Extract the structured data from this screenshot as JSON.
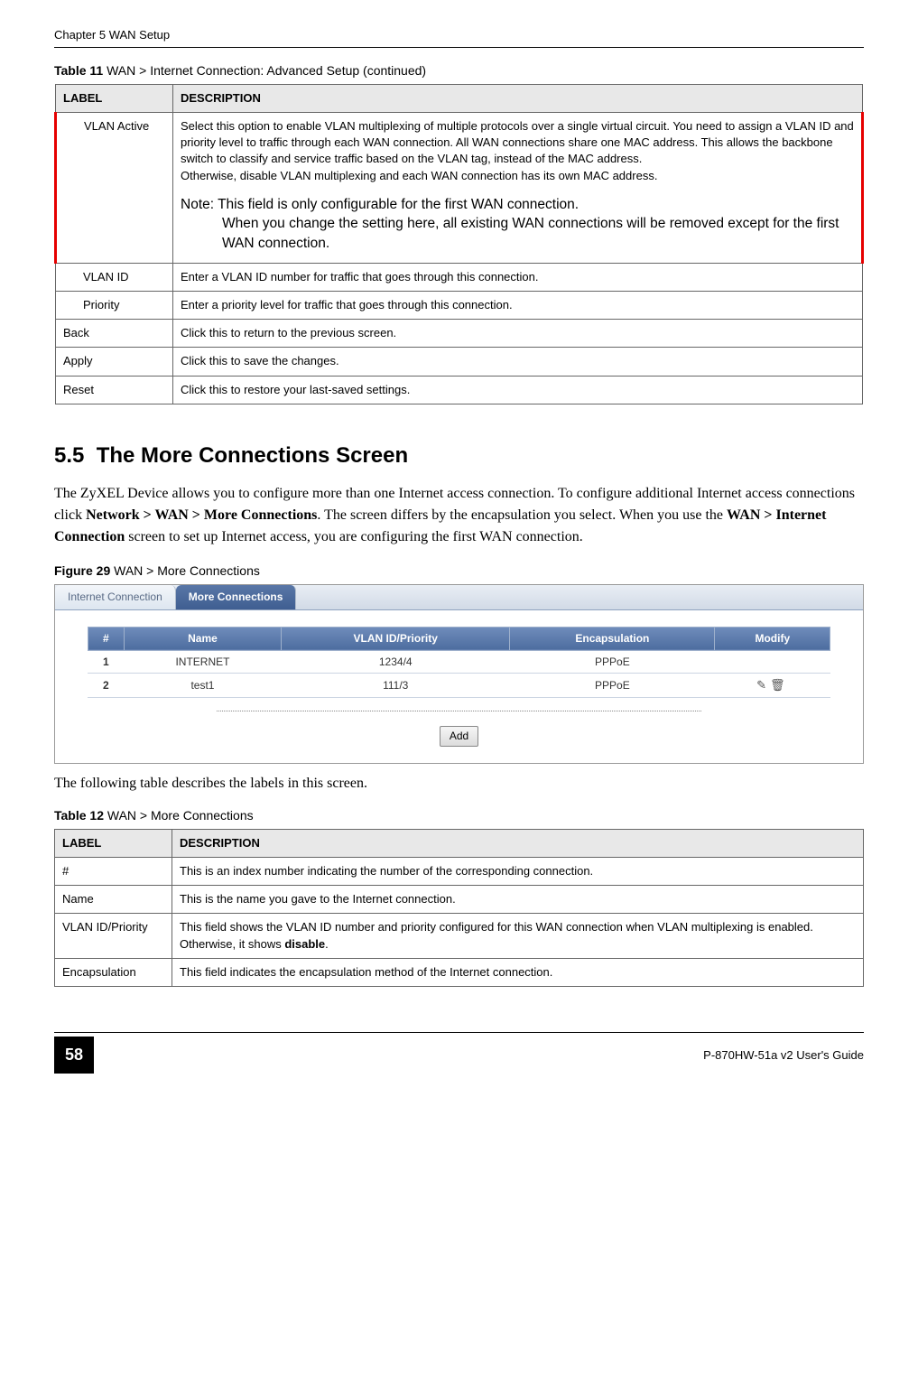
{
  "header": {
    "left": "Chapter 5 WAN Setup"
  },
  "table11": {
    "caption_bold": "Table 11",
    "caption_rest": "   WAN > Internet Connection: Advanced Setup (continued)",
    "col_label": "LABEL",
    "col_desc": "DESCRIPTION",
    "rows": [
      {
        "label": "VLAN Active",
        "desc": "Select this option to enable VLAN multiplexing of multiple protocols over a single virtual circuit. You need to assign a VLAN ID and priority level to traffic through each WAN connection. All WAN connections share one MAC address. This allows the backbone switch to classify and service traffic based on the VLAN tag, instead of the MAC address.",
        "desc2": "Otherwise, disable VLAN multiplexing and each WAN connection has its own MAC address.",
        "note_lead": "Note: This field is only configurable for the first WAN connection.",
        "note_rest": "When you change the setting here, all existing WAN connections will be removed except for the first WAN connection.",
        "highlight": true,
        "indent": true
      },
      {
        "label": "VLAN ID",
        "desc": "Enter a VLAN ID number for traffic that goes through this connection.",
        "indent": true
      },
      {
        "label": "Priority",
        "desc": "Enter a priority level for traffic that goes through this connection.",
        "indent": true
      },
      {
        "label": "Back",
        "desc": "Click this to return to the previous screen."
      },
      {
        "label": "Apply",
        "desc": "Click this to save the changes."
      },
      {
        "label": "Reset",
        "desc": "Click this to restore your last-saved settings."
      }
    ]
  },
  "section": {
    "number": "5.5",
    "title": "The More Connections Screen",
    "para_parts": [
      "The ZyXEL Device allows you to configure more than one Internet access connection. To configure additional Internet access connections click ",
      "Network > WAN > More Connections",
      ". The screen differs by the encapsulation you select. When you use the ",
      "WAN > Internet Connection",
      " screen to set up Internet access, you are configuring the first WAN connection."
    ]
  },
  "figure29": {
    "caption_bold": "Figure 29",
    "caption_rest": "   WAN > More Connections",
    "tabs": {
      "t1": "Internet Connection",
      "t2": "More Connections"
    },
    "cols": {
      "num": "#",
      "name": "Name",
      "vlan": "VLAN ID/Priority",
      "encap": "Encapsulation",
      "modify": "Modify"
    },
    "rows": [
      {
        "num": "1",
        "name": "INTERNET",
        "vlan": "1234/4",
        "encap": "PPPoE",
        "modify": ""
      },
      {
        "num": "2",
        "name": "test1",
        "vlan": "111/3",
        "encap": "PPPoE",
        "modify": "icons"
      }
    ],
    "add": "Add"
  },
  "para_after_fig": "The following table describes the labels in this screen.",
  "table12": {
    "caption_bold": "Table 12",
    "caption_rest": "   WAN > More Connections",
    "col_label": "LABEL",
    "col_desc": "DESCRIPTION",
    "rows": [
      {
        "label": "#",
        "desc": "This is an index number indicating the number of the corresponding connection."
      },
      {
        "label": "Name",
        "desc": "This is the name you gave to the Internet connection."
      },
      {
        "label": "VLAN ID/Priority",
        "desc": "This field shows the VLAN ID number and priority configured for this WAN connection when VLAN multiplexing is enabled. Otherwise, it shows disable.",
        "bold_tail": "disable"
      },
      {
        "label": "Encapsulation",
        "desc": "This field indicates the encapsulation method of the Internet connection."
      }
    ]
  },
  "footer": {
    "page": "58",
    "guide": "P-870HW-51a v2 User's Guide"
  }
}
